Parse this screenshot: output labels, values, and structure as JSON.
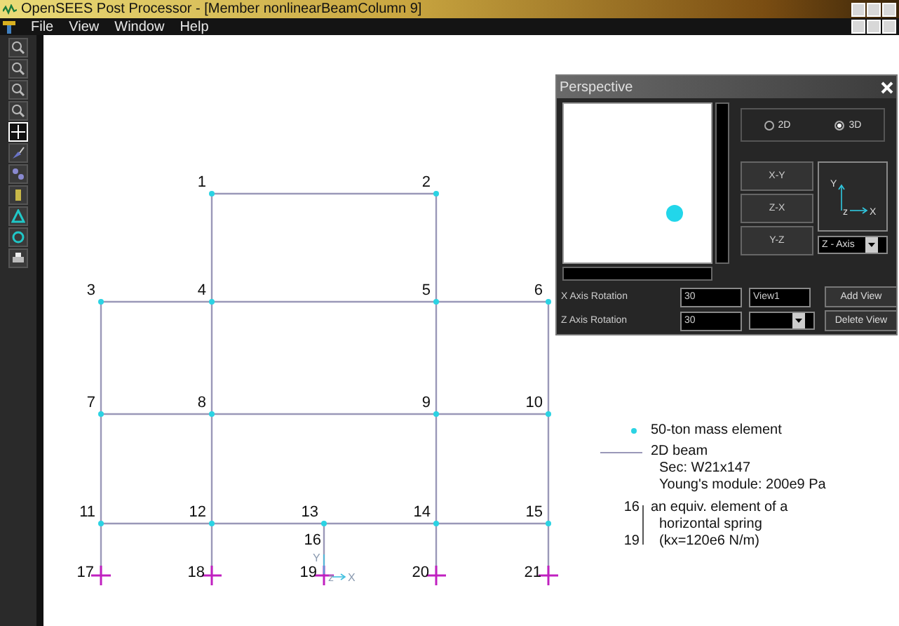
{
  "window": {
    "title": "OpenSEES Post Processor - [Member nonlinearBeamColumn 9]"
  },
  "menu": [
    "File",
    "View",
    "Window",
    "Help"
  ],
  "toolbar": [
    {
      "kind": "zoom",
      "selected": false
    },
    {
      "kind": "zoom",
      "selected": false
    },
    {
      "kind": "zoom",
      "selected": false
    },
    {
      "kind": "zoom",
      "selected": false
    },
    {
      "kind": "pan",
      "selected": true
    },
    {
      "kind": "paint",
      "selected": false
    },
    {
      "kind": "node",
      "selected": false
    },
    {
      "kind": "element",
      "selected": false
    },
    {
      "kind": "triangle",
      "selected": false
    },
    {
      "kind": "circle",
      "selected": false
    },
    {
      "kind": "print",
      "selected": false
    }
  ],
  "model": {
    "nodes": [
      {
        "label": "1",
        "kind": "mass"
      },
      {
        "label": "2",
        "kind": "mass"
      },
      {
        "label": "3",
        "kind": "mass"
      },
      {
        "label": "4",
        "kind": "mass"
      },
      {
        "label": "5",
        "kind": "mass"
      },
      {
        "label": "6",
        "kind": "mass"
      },
      {
        "label": "7",
        "kind": "mass"
      },
      {
        "label": "8",
        "kind": "mass"
      },
      {
        "label": "9",
        "kind": "mass"
      },
      {
        "label": "10",
        "kind": "mass"
      },
      {
        "label": "11",
        "kind": "mass"
      },
      {
        "label": "12",
        "kind": "mass"
      },
      {
        "label": "13",
        "kind": "mass"
      },
      {
        "label": "14",
        "kind": "mass"
      },
      {
        "label": "15",
        "kind": "mass"
      },
      {
        "label": "16",
        "kind": "plain"
      },
      {
        "label": "17",
        "kind": "fixed"
      },
      {
        "label": "18",
        "kind": "fixed"
      },
      {
        "label": "19",
        "kind": "fixed"
      },
      {
        "label": "20",
        "kind": "fixed"
      },
      {
        "label": "21",
        "kind": "fixed"
      }
    ],
    "local_axes": {
      "y": "Y",
      "z": "z",
      "x": "X"
    }
  },
  "perspective": {
    "title": "Perspective",
    "modes": [
      {
        "label": "2D",
        "selected": false
      },
      {
        "label": "3D",
        "selected": true
      }
    ],
    "view_buttons": [
      "X-Y",
      "Z-X",
      "Y-Z"
    ],
    "axes": {
      "y": "Y",
      "z": "z",
      "x": "X"
    },
    "axis_select": "Z - Axis",
    "x_rotation": {
      "label": "X Axis Rotation",
      "value": "30"
    },
    "z_rotation": {
      "label": "Z Axis Rotation",
      "value": "30"
    },
    "view_name": "View1",
    "buttons": [
      "Add View",
      "Delete View"
    ]
  },
  "legend": {
    "mass": "50-ton mass element",
    "beam": [
      "2D beam",
      "Sec: W21x147",
      "Young's module: 200e9 Pa"
    ],
    "spring_nodes": [
      "16",
      "19"
    ],
    "spring": [
      "an equiv. element of a",
      "horizontal spring",
      "(kx=120e6 N/m)"
    ]
  }
}
